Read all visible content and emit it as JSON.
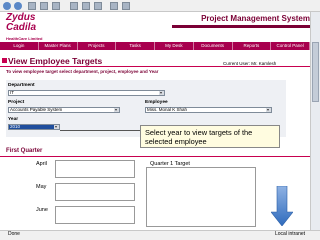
{
  "header": {
    "logo_line1": "Zydus",
    "logo_line2": "Cadila",
    "logo_sub": "HealthCare Limited",
    "system_title": "Project Management System"
  },
  "nav": {
    "items": [
      "Login",
      "Master Plans",
      "Projects",
      "Tasks",
      "My Desk",
      "Documents",
      "Reports",
      "Control Panel"
    ]
  },
  "page": {
    "title": "View Employee Targets",
    "current_user": "Current User: Mr. Kamlesh",
    "instruction": "To view employee target select department, project, employee and Year"
  },
  "filters": {
    "department_label": "Department",
    "department_value": "IT",
    "project_label": "Project",
    "project_value": "Accounts Payable System",
    "employee_label": "Employee",
    "employee_value": "Miss. Monal K Shah",
    "year_label": "Year",
    "year_value": "2010"
  },
  "callout": {
    "text": "Select year to view targets of the selected employee"
  },
  "quarter": {
    "title": "First Quarter",
    "months": [
      "April",
      "May",
      "June"
    ],
    "target_label": "Quarter 1 Target"
  },
  "status": {
    "left": "Done",
    "right": "Local intranet"
  },
  "colors": {
    "brand": "#a8004e",
    "accent_dark": "#7a0035",
    "selected_year": "#1f4e9d"
  }
}
